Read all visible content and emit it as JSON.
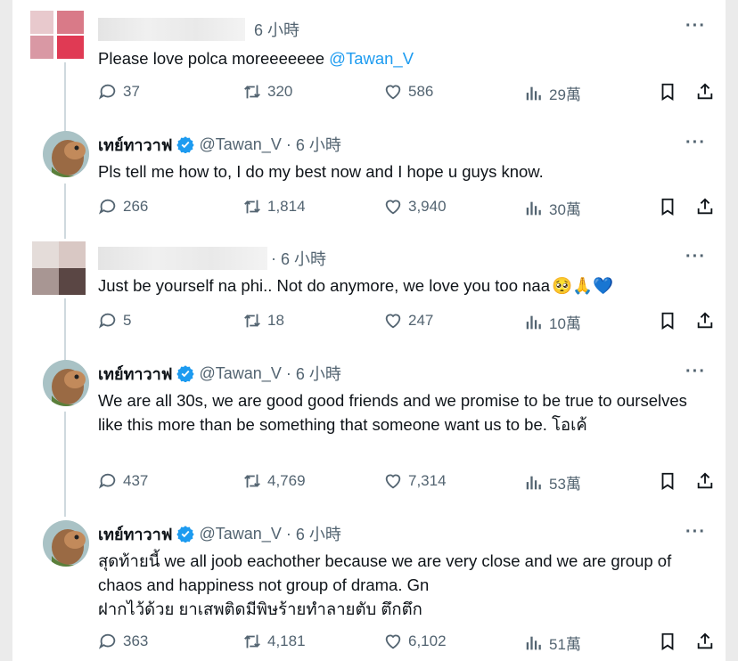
{
  "colors": {
    "link": "#1d9bf0",
    "muted": "#536471",
    "verified": "#1d9bf0",
    "heart_emoji": "#5aa8f5"
  },
  "tweets": [
    {
      "name": "",
      "handle": "",
      "sep": "",
      "time": "6 小時",
      "text": "Please love polca moreeeeeee ",
      "mention": "@Tawan_V",
      "replies": "37",
      "retweets": "320",
      "likes": "586",
      "views": "29萬"
    },
    {
      "name": "เทย์ทาวาฟ",
      "handle": "@Tawan_V",
      "sep": "·",
      "time": "6 小時",
      "text": "Pls tell me how to, I do my best now and I hope u guys know.",
      "replies": "266",
      "retweets": "1,814",
      "likes": "3,940",
      "views": "30萬"
    },
    {
      "name": "",
      "handle": "",
      "sep": "·",
      "time": "6 小時",
      "text": "Just be yourself na phi.. Not do anymore, we love you too naa",
      "emoji": "🥺🙏💙",
      "replies": "5",
      "retweets": "18",
      "likes": "247",
      "views": "10萬"
    },
    {
      "name": "เทย์ทาวาฟ",
      "handle": "@Tawan_V",
      "sep": "·",
      "time": "6 小時",
      "text": "We are all 30s, we are good good friends and we promise to be true to ourselves like this more than be something that someone want us to be. โอเค้",
      "replies": "437",
      "retweets": "4,769",
      "likes": "7,314",
      "views": "53萬"
    },
    {
      "name": "เทย์ทาวาฟ",
      "handle": "@Tawan_V",
      "sep": "·",
      "time": "6 小時",
      "text": "สุดท้ายนี้ we all joob eachother because we are very close and we are group of chaos and happiness not group of drama. Gn",
      "text2": "ฝากไว้ด้วย ยาเสพติดมีพิษร้ายทำลายตับ ตึกตึก",
      "replies": "363",
      "retweets": "4,181",
      "likes": "6,102",
      "views": "51萬"
    }
  ],
  "icons": {
    "reply": "reply-icon",
    "retweet": "retweet-icon",
    "like": "heart-icon",
    "views": "views-icon",
    "bookmark": "bookmark-icon",
    "share": "share-icon",
    "more": "more-icon"
  },
  "more_glyph": "···"
}
